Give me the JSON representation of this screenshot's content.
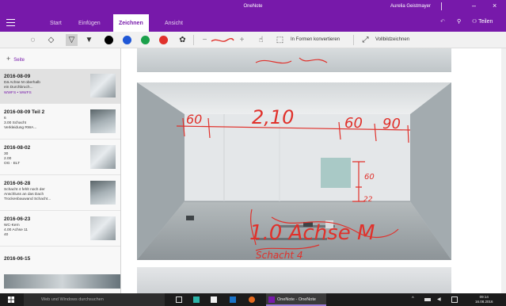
{
  "window": {
    "title": "OneNote",
    "user": "Aurelia Geistmayer"
  },
  "ribbon": {
    "tabs": [
      {
        "label": "Start"
      },
      {
        "label": "Einfügen"
      },
      {
        "label": "Zeichnen"
      },
      {
        "label": "Ansicht"
      }
    ],
    "active_tab": "Zeichnen",
    "share_label": "Teilen"
  },
  "toolbar": {
    "pen_colors": [
      "#000000",
      "#1f57d6",
      "#1aa04a",
      "#e0312b"
    ],
    "convert_label": "In Formen konvertieren",
    "fullscreen_label": "Vollbildzeichnen"
  },
  "pages": {
    "add_label": "Seite",
    "items": [
      {
        "title": "2016-08-09",
        "lines": [
          "Dä Achse M oberhalb",
          "ein Durchbruch..."
        ],
        "tags": "WWFS • WWFS",
        "selected": true
      },
      {
        "title": "2016-08-09 Teil 2",
        "lines": [
          "6",
          "3.00 Schacht",
          "Verkleidung RWA..."
        ],
        "tags": "",
        "selected": false
      },
      {
        "title": "2016-08-02",
        "lines": [
          "30",
          "2.00",
          "OG · ELT"
        ],
        "tags": "",
        "selected": false
      },
      {
        "title": "2016-06-28",
        "lines": [
          "Schacht 4 fehlt noch der",
          "Anschluss an das Dach",
          "Trockenbauwand Schacht..."
        ],
        "tags": "",
        "selected": false
      },
      {
        "title": "2016-06-23",
        "lines": [
          "WC-Kern",
          "4.00 Achse 11",
          "40"
        ],
        "tags": "",
        "selected": false
      }
    ],
    "last_title": "2016-06-15"
  },
  "canvas": {
    "annotations": {
      "dim_a": "60",
      "dim_b": "2,10",
      "dim_c": "60",
      "dim_d": "90",
      "dim_e": "60",
      "dim_f": "22",
      "note_main": "1.0 Achse M",
      "note_sub": "Schacht 4"
    },
    "ink_color": "#e0312b"
  },
  "taskbar": {
    "search_placeholder": "Web und Windows durchsuchen",
    "app_label": "OneNote - OneNote",
    "time": "09:14",
    "date": "16.08.2016"
  }
}
